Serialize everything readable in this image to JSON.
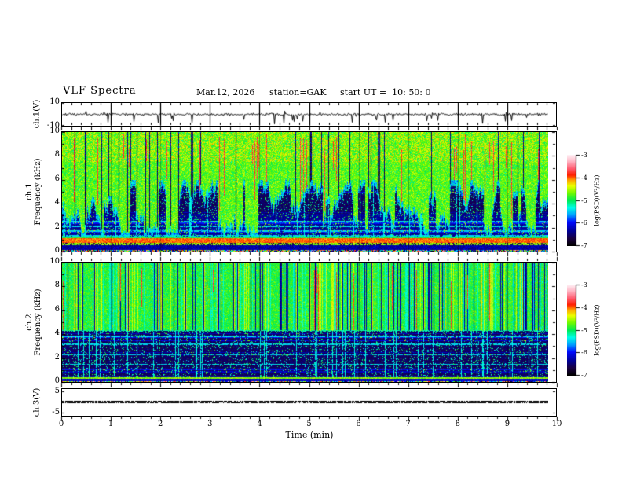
{
  "header": {
    "title": "VLF Spectra",
    "date": "Mar.12, 2026",
    "station": "station=GAK",
    "start_ut": "start UT =  10: 50: 0"
  },
  "chart_data": {
    "type": "heatmap",
    "description": "Four stacked time panels: ch.1 voltage waveform, ch.1 spectrogram, ch.2 spectrogram, ch.3 voltage trace, sharing a 0-10 minute time axis; two PSD colorbars at right.",
    "x": {
      "label": "Time (min)",
      "range": [
        0,
        10
      ],
      "major_ticks": [
        "0",
        "1",
        "2",
        "3",
        "4",
        "5",
        "6",
        "7",
        "8",
        "9",
        "10"
      ],
      "minor_step_min": 0.2,
      "data_end_min": 9.8
    },
    "panels": {
      "ch1_wave": {
        "kind": "line",
        "ylabel": "ch.1(V)",
        "yrange": [
          -10,
          10
        ],
        "yticks": [
          {
            "v": 10,
            "label": "10"
          },
          {
            "v": -10,
            "label": "-10"
          }
        ],
        "signal": {
          "mean_v": 0,
          "noise_sigma_v": 1.2,
          "spike_depth_v": -9,
          "spike_character": "dense broadband noise around 0 V with frequent narrow downward spikes"
        }
      },
      "ch1_spec": {
        "kind": "heatmap",
        "ylabel_line1": "ch.1",
        "ylabel_line2": "Frequency (kHz)",
        "yrange_khz": [
          0,
          10
        ],
        "yticks": [
          {
            "v": 10,
            "label": "10"
          },
          {
            "v": 8,
            "label": "8"
          },
          {
            "v": 6,
            "label": "6"
          },
          {
            "v": 4,
            "label": "4"
          },
          {
            "v": 2,
            "label": "2"
          },
          {
            "v": 0,
            "label": "0"
          }
        ],
        "upper_psd": -4.75,
        "lower_psd": -6.55,
        "red_streak_psd": -3.75,
        "cutoff_khz": [
          1.6,
          6.0
        ],
        "hlines_khz": [
          1.35,
          1.75,
          2.15,
          2.55
        ],
        "bands": [
          [
            1.17,
            1.3,
            -5.0,
            ""
          ],
          [
            0.78,
            1.17,
            -4.0,
            ""
          ],
          [
            0.58,
            0.78,
            -4.6,
            "mix"
          ],
          [
            0.19,
            0.58,
            -6.3,
            ""
          ],
          [
            0.0,
            0.19,
            null,
            ""
          ]
        ]
      },
      "ch2_spec": {
        "kind": "heatmap",
        "ylabel_line1": "ch.2",
        "ylabel_line2": "Frequency (kHz)",
        "yrange_khz": [
          0,
          10
        ],
        "yticks": [
          {
            "v": 10,
            "label": "10"
          },
          {
            "v": 8,
            "label": "8"
          },
          {
            "v": 6,
            "label": "6"
          },
          {
            "v": 4,
            "label": "4"
          },
          {
            "v": 2,
            "label": "2"
          },
          {
            "v": 0,
            "label": "0"
          }
        ],
        "upper_psd": -4.9,
        "lower_psd": -6.55,
        "red_streak_psd": -3.8,
        "boundary_khz": 4.35,
        "hlines_khz": [
          1.5,
          2.3,
          3.2,
          3.85
        ],
        "bands": [
          [
            0.28,
            0.42,
            -4.6,
            ""
          ],
          [
            0.1,
            0.28,
            -6.2,
            ""
          ],
          [
            0.0,
            0.1,
            null,
            ""
          ]
        ]
      },
      "ch3_wave": {
        "kind": "line",
        "ylabel": "ch.3(V)",
        "yticks": [
          {
            "v": 5,
            "label": "5"
          },
          {
            "v": -5,
            "label": "-5"
          }
        ],
        "signal": {
          "constant_v": 0,
          "character": "flat thick black line at 0 V for the full record"
        }
      }
    },
    "colorbar": {
      "label": "log(PSD)(V²/Hz)",
      "ticks": [
        "-3",
        "-4",
        "-5",
        "-6",
        "-7"
      ],
      "range": [
        -7,
        -3
      ]
    },
    "colormap": {
      "range": [
        -7,
        -3
      ],
      "stops": [
        [
          0.0,
          "#000000"
        ],
        [
          0.08,
          "#190040"
        ],
        [
          0.16,
          "#000096"
        ],
        [
          0.26,
          "#000aff"
        ],
        [
          0.34,
          "#00a0ff"
        ],
        [
          0.42,
          "#00ffe6"
        ],
        [
          0.5,
          "#00eb50"
        ],
        [
          0.58,
          "#6efa00"
        ],
        [
          0.66,
          "#ebff00"
        ],
        [
          0.72,
          "#ffaa00"
        ],
        [
          0.78,
          "#ff1e00"
        ],
        [
          0.85,
          "#ff5a6e"
        ],
        [
          0.93,
          "#ffb4c3"
        ],
        [
          1.0,
          "#fff0f5"
        ]
      ]
    }
  }
}
